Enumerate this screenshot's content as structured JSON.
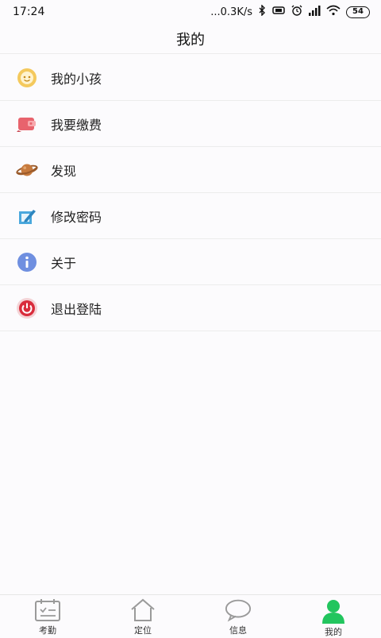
{
  "status": {
    "time": "17:24",
    "network_speed": "...0.3K/s",
    "battery": "54"
  },
  "header": {
    "title": "我的"
  },
  "menu": [
    {
      "label": "我的小孩",
      "icon": "child-face-icon"
    },
    {
      "label": "我要缴费",
      "icon": "wallet-icon"
    },
    {
      "label": "发现",
      "icon": "planet-icon"
    },
    {
      "label": "修改密码",
      "icon": "edit-password-icon"
    },
    {
      "label": "关于",
      "icon": "info-icon"
    },
    {
      "label": "退出登陆",
      "icon": "power-icon"
    }
  ],
  "tabs": [
    {
      "label": "考勤",
      "icon": "calendar-icon",
      "active": false
    },
    {
      "label": "定位",
      "icon": "home-icon",
      "active": false
    },
    {
      "label": "信息",
      "icon": "chat-bubble-icon",
      "active": false
    },
    {
      "label": "我的",
      "icon": "person-icon",
      "active": true
    }
  ],
  "colors": {
    "active_tab": "#22c55e",
    "inactive_tab": "#9a9a9a"
  }
}
